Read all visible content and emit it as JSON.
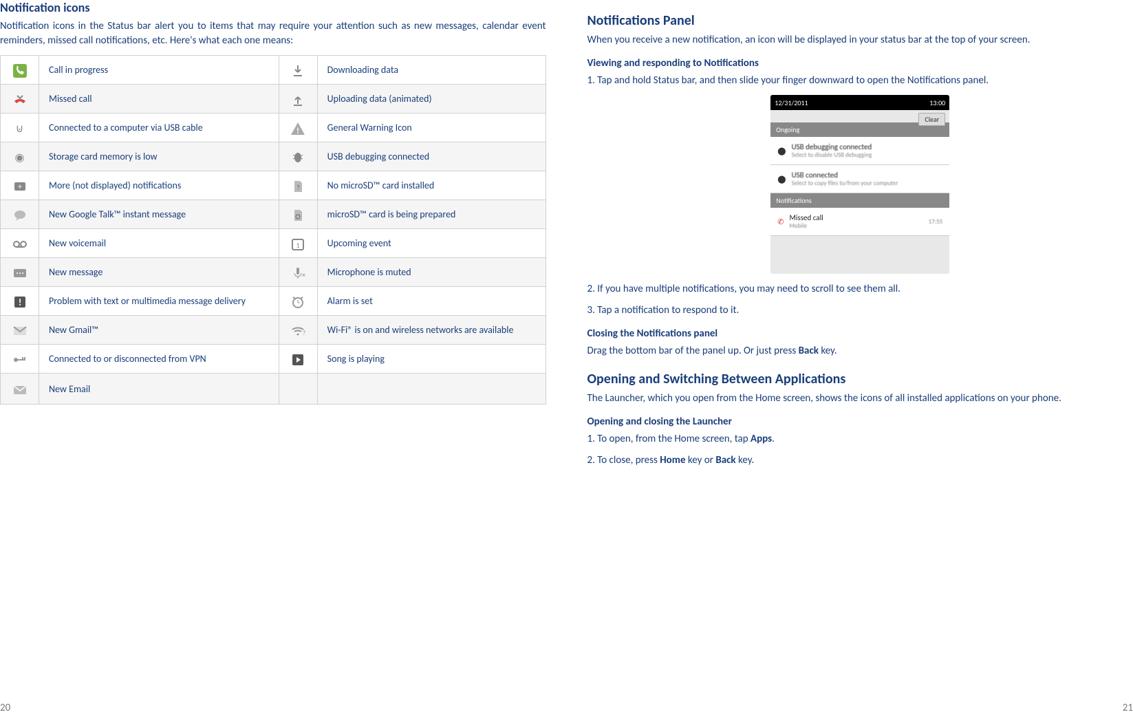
{
  "left": {
    "title": "Notification icons",
    "intro": "Notification icons in the Status bar alert you to items that may require your attention such as new messages, calendar event reminders, missed call notifications, etc. Here's what each one means:",
    "rows": [
      {
        "icon": "call-in-progress-icon",
        "label": "Call in progress",
        "icon2": "download-icon",
        "label2": "Downloading data"
      },
      {
        "icon": "missed-call-icon",
        "label": "Missed call",
        "icon2": "upload-icon",
        "label2": "Uploading data (animated)"
      },
      {
        "icon": "usb-icon",
        "label": "Connected to a computer via USB cable",
        "icon2": "warning-icon",
        "label2": "General Warning Icon"
      },
      {
        "icon": "storage-low-icon",
        "label": "Storage card memory is low",
        "icon2": "usb-debug-icon",
        "label2": "USB debugging connected"
      },
      {
        "icon": "more-notifications-icon",
        "label": "More (not displayed) notifications",
        "icon2": "no-sd-icon",
        "label2": "No microSD™ card installed"
      },
      {
        "icon": "gtalk-icon",
        "label": "New Google Talk™ instant message",
        "icon2": "sd-preparing-icon",
        "label2": "microSD™ card is being prepared"
      },
      {
        "icon": "voicemail-icon",
        "label": "New voicemail",
        "icon2": "calendar-event-icon",
        "label2": "Upcoming event"
      },
      {
        "icon": "new-message-icon",
        "label": "New message",
        "icon2": "mic-muted-icon",
        "label2": "Microphone is muted"
      },
      {
        "icon": "message-problem-icon",
        "label": "Problem with text or multimedia message delivery",
        "icon2": "alarm-icon",
        "label2": "Alarm is set"
      },
      {
        "icon": "gmail-icon",
        "label": "New Gmail™",
        "icon2": "wifi-icon",
        "label2": "Wi-Fi® is on and wireless networks are available"
      },
      {
        "icon": "vpn-icon",
        "label": "Connected to or disconnected from VPN",
        "icon2": "song-playing-icon",
        "label2": "Song is playing"
      },
      {
        "icon": "email-icon",
        "label": "New Email",
        "icon2": "",
        "label2": ""
      }
    ],
    "pagenum": "20"
  },
  "right": {
    "title": "Notifications Panel",
    "intro": "When you receive a new notification, an icon will be displayed in your status bar at the top of your screen.",
    "viewing_title": "Viewing and responding to Notifications",
    "step1": "1. Tap and hold Status bar, and then slide your finger downward to open the Notifications panel.",
    "screenshot": {
      "time": "12/31/2011",
      "clock": "13:00",
      "clear": "Clear",
      "ongoing": "Ongoing",
      "usb_debug": "USB debugging connected",
      "usb_debug_sub": "Select to disable USB debugging",
      "usb_conn": "USB connected",
      "usb_conn_sub": "Select to copy files to/from your computer",
      "notif_hdr": "Notifications",
      "missed": "Missed call",
      "missed_sub": "Mobile",
      "missed_time": "17:55"
    },
    "step2": "2. If you have multiple notifications, you may need to scroll to see them all.",
    "step3": "3. Tap a notification to respond to it.",
    "closing_title": "Closing the Notifications panel",
    "closing_text_pre": "Drag the bottom bar of the panel up. Or just press ",
    "closing_text_bold": "Back",
    "closing_text_post": " key.",
    "opening_title": "Opening and Switching Between Applications",
    "opening_text": "The Launcher, which you open from the Home screen, shows the icons of all installed applications on your phone.",
    "launcher_title": "Opening and closing the Launcher",
    "launcher_step1_pre": "1. To open, from the Home screen, tap ",
    "launcher_step1_bold": "Apps",
    "launcher_step1_post": ".",
    "launcher_step2_pre": "2. To close, press ",
    "launcher_step2_bold1": "Home",
    "launcher_step2_mid": " key or ",
    "launcher_step2_bold2": "Back",
    "launcher_step2_post": " key.",
    "pagenum": "21"
  }
}
